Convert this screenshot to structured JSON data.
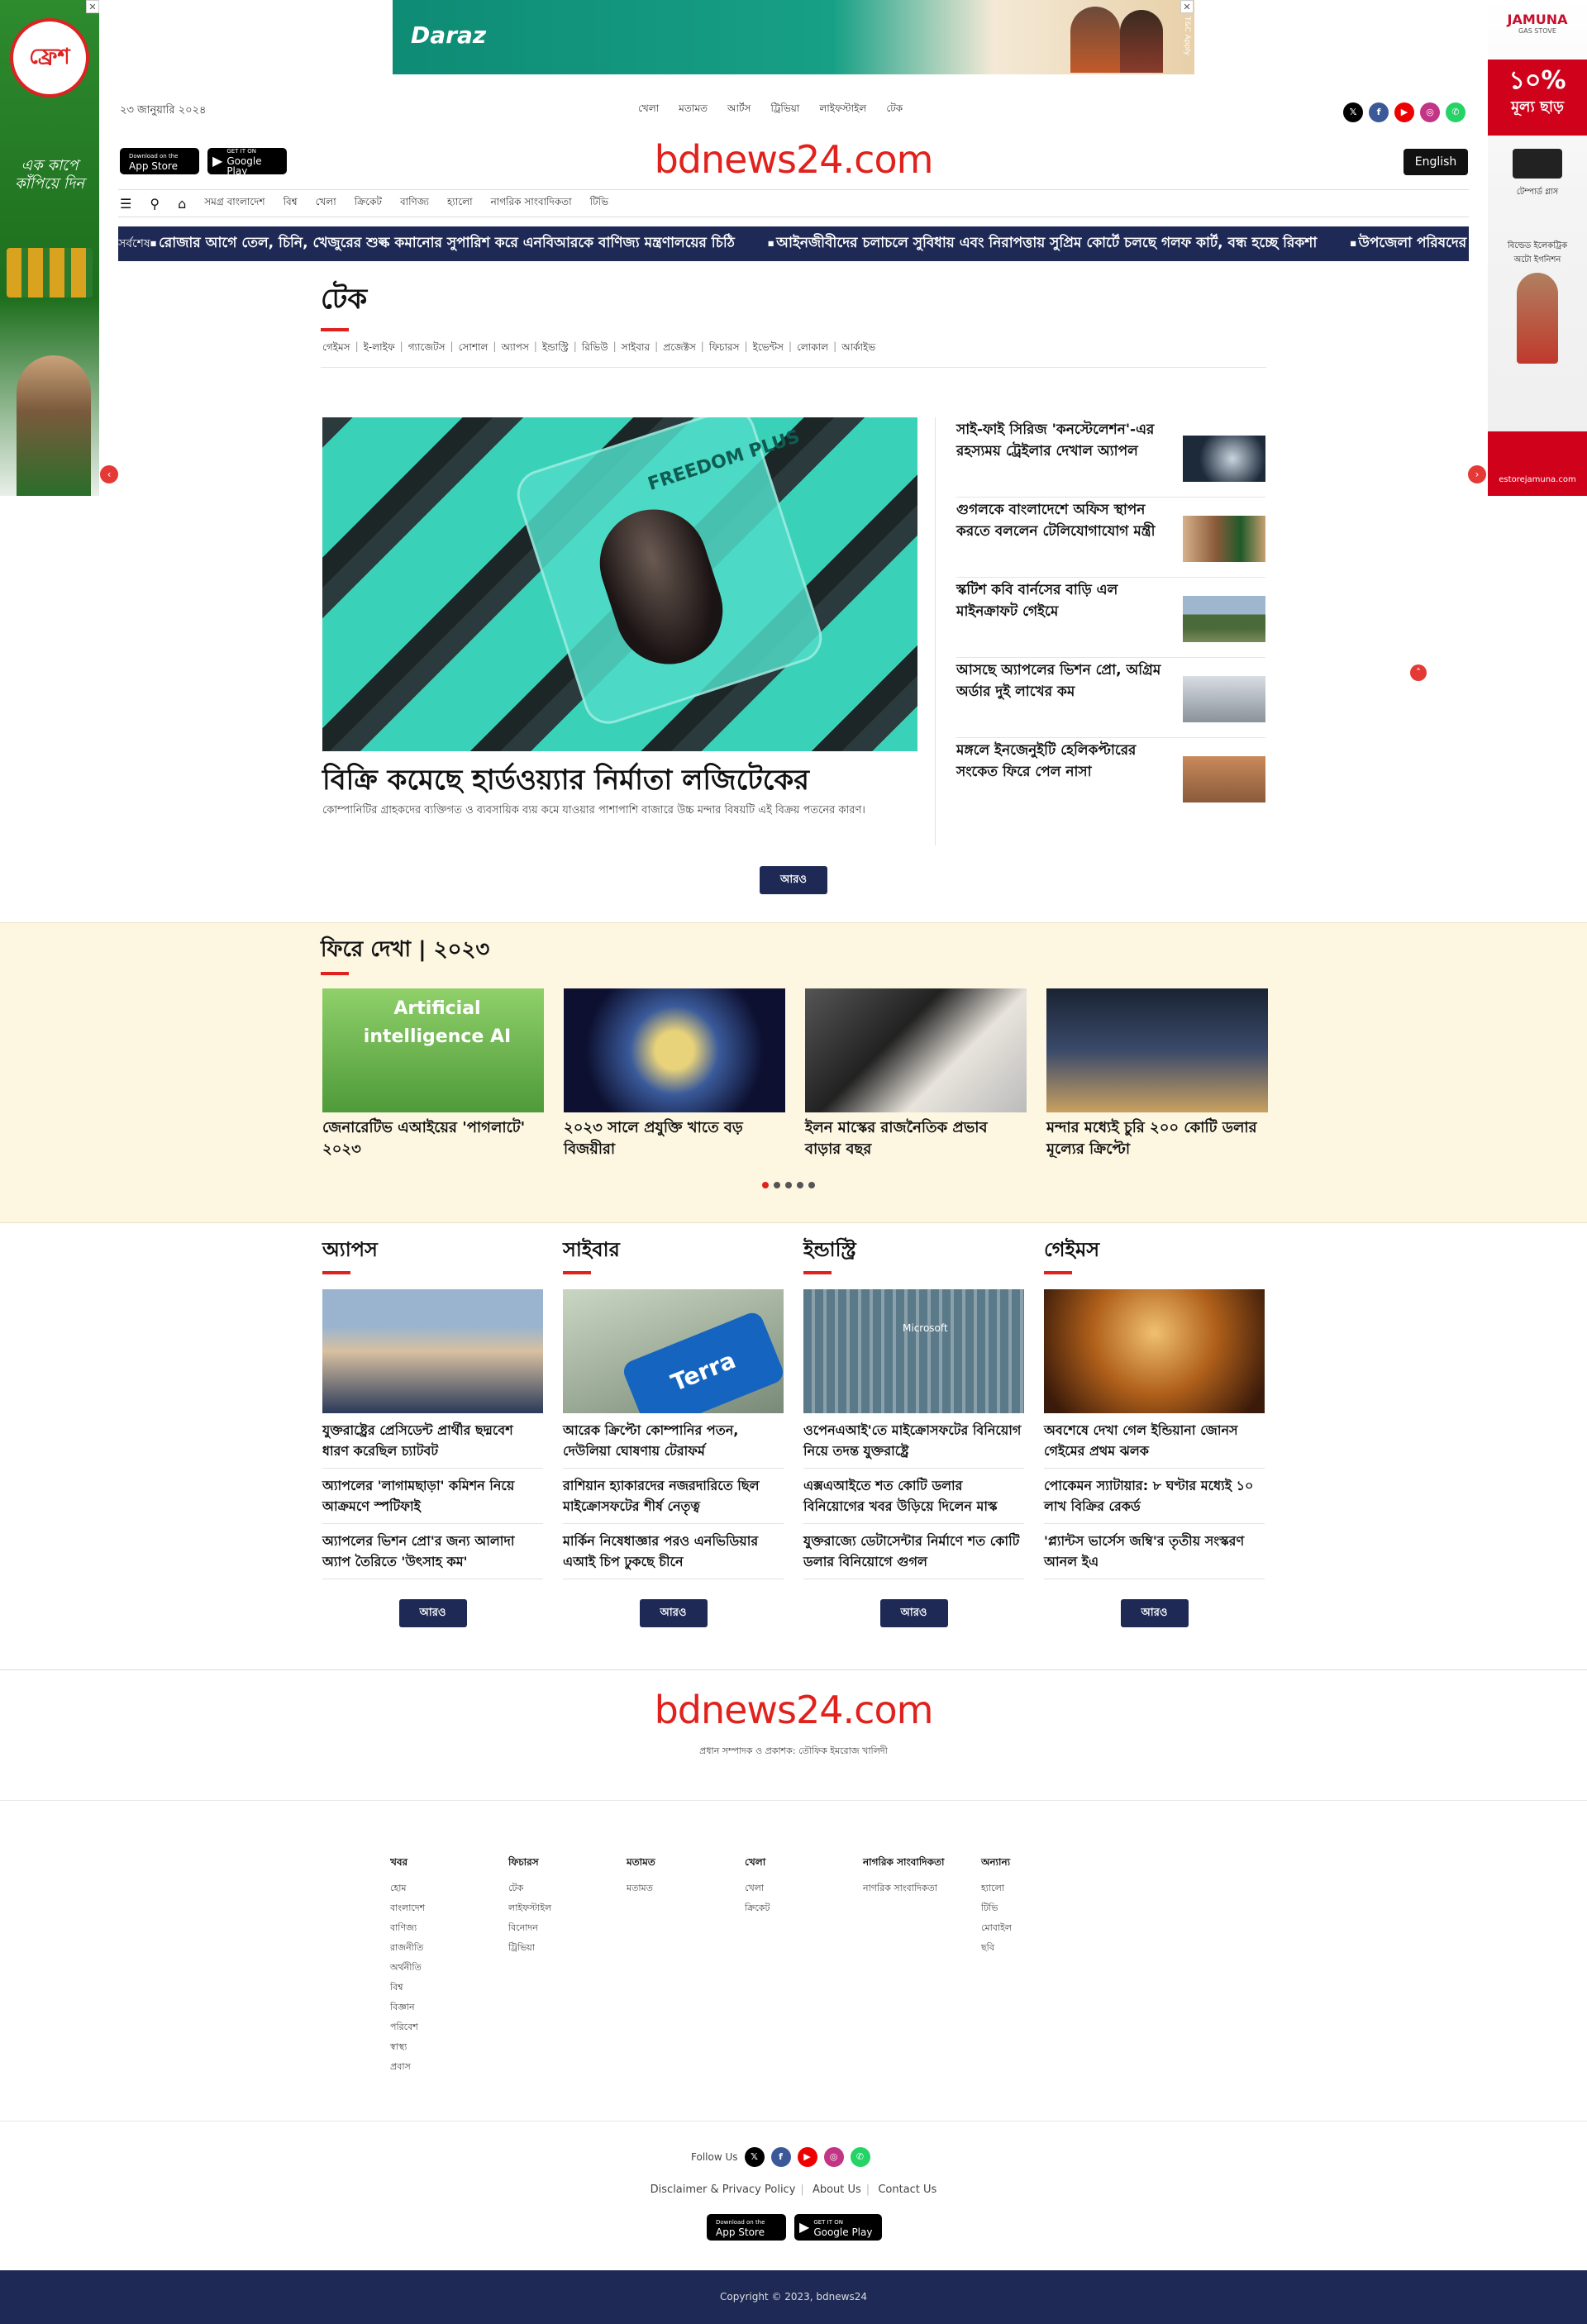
{
  "ads": {
    "left_brand": "ফ্রেশ",
    "left_tagline": "এক কাপে কাঁপিয়ে দিন",
    "right_brand": "JAMUNA",
    "right_brand_sub": "GAS STOVE",
    "right_offer_pct": "১০%",
    "right_offer_text": "মূল্য ছাড়",
    "right_prod1": "টেম্পার্ড গ্লাস",
    "right_prod2": "বিল্ডেড ইলেকট্রিক অটো ইগনিশন",
    "right_site": "estorejamuna.com",
    "banner_brand": "Daraz",
    "banner_tc": "T&C Apply"
  },
  "header": {
    "date": "২৩ জানুয়ারি ২০২৪",
    "top_nav": [
      "খেলা",
      "মতামত",
      "আর্টস",
      "ট্রিভিয়া",
      "লাইফস্টাইল",
      "টেক"
    ],
    "logo": "bdnews24.com",
    "english": "English",
    "app_store": "App Store",
    "app_store_small": "Download on the",
    "google_play": "Google Play",
    "google_play_small": "GET IT ON"
  },
  "nav": [
    "সমগ্র বাংলাদেশ",
    "বিশ্ব",
    "খেলা",
    "ক্রিকেট",
    "বাণিজ্য",
    "হ্যালো",
    "নাগরিক সাংবাদিকতা",
    "টিভি"
  ],
  "ticker": {
    "label": "সর্বশেষ",
    "items": [
      "রোজার আগে তেল, চিনি, খেজুরের শুল্ক কমানোর সুপারিশ করে এনবিআরকে বাণিজ্য মন্ত্রণালয়ের চিঠি",
      "আইনজীবীদের চলাচলে সুবিধায় এবং নিরাপত্তায় সুপ্রিম কোর্টে চলছে গলফ কার্ট, বন্ধ হচ্ছে রিকশা",
      "উপজেলা পরিষদের ভোট মে"
    ]
  },
  "section": {
    "title": "টেক",
    "subnav": [
      "গেইমস",
      "ই-লাইফ",
      "গ্যাজেটস",
      "সোশাল",
      "অ্যাপস",
      "ইন্ডাস্ট্রি",
      "রিভিউ",
      "সাইবার",
      "প্রজেক্টস",
      "ফিচারস",
      "ইভেন্টস",
      "লোকাল",
      "আর্কাইভ"
    ]
  },
  "lead": {
    "title": "বিক্রি কমেছে হার্ডওয়্যার নির্মাতা লজিটেকের",
    "desc": "কোম্পানিটির গ্রাহকদের ব্যক্তিগত ও ব্যবসায়িক ব্যয় কমে যাওয়ার পাশাপাশি বাজারে উচ্চ মন্দার বিষয়টি এই বিক্রয় পতনের কারণ।",
    "img_text": "FREEDOM PLUS"
  },
  "side_news": [
    "সাই-ফাই সিরিজ 'কনস্টেলেশন'-এর রহস্যময় ট্রেইলার দেখাল অ্যাপল",
    "গুগলকে বাংলাদেশে অফিস স্থাপন করতে বললেন টেলিযোগাযোগ মন্ত্রী",
    "স্কটিশ কবি বার্নসের বাড়ি এল মাইনক্রাফট গেইমে",
    "আসছে অ্যাপলের ভিশন প্রো, অগ্রিম অর্ডার দুই লাখের কম",
    "মঙ্গলে ইনজেনুইটি হেলিকপ্টারের সংকেত ফিরে পেল নাসা"
  ],
  "more_label": "আরও",
  "review": {
    "title": "ফিরে দেখা | ২০২৩",
    "cards": [
      {
        "title": "জেনারেটিভ এআইয়ের 'পাগলাটে' ২০২৩",
        "img_text": "Artificial intelligence AI"
      },
      {
        "title": "২০২৩ সালে প্রযুক্তি খাতে বড় বিজয়ীরা",
        "img_text": ""
      },
      {
        "title": "ইলন মাস্কের রাজনৈতিক প্রভাব বাড়ার বছর",
        "img_text": ""
      },
      {
        "title": "মন্দার মধ্যেই চুরি ২০০ কোটি ডলার মূল্যের ক্রিপ্টো",
        "img_text": ""
      }
    ]
  },
  "categories": [
    {
      "title": "অ্যাপস",
      "items": [
        "যুক্তরাষ্ট্রের প্রেসিডেন্ট প্রার্থীর ছদ্মবেশ ধারণ করেছিল চ্যাটবট",
        "অ্যাপলের 'লাগামছাড়া' কমিশন নিয়ে আক্রমণে স্পটিফাই",
        "অ্যাপলের ভিশন প্রো'র জন্য আলাদা অ্যাপ তৈরিতে 'উৎসাহ কম'"
      ]
    },
    {
      "title": "সাইবার",
      "items": [
        "আরেক ক্রিপ্টো কোম্পানির পতন, দেউলিয়া ঘোষণায় টেরাফর্ম",
        "রাশিয়ান হ্যাকারদের নজরদারিতে ছিল মাইক্রোসফটের শীর্ষ নেতৃত্ব",
        "মার্কিন নিষেধাজ্ঞার পরও এনভিডিয়ার এআই চিপ ঢুকছে চীনে"
      ],
      "img_text": "Terra"
    },
    {
      "title": "ইন্ডাস্ট্রি",
      "items": [
        "ওপেনএআই'তে মাইক্রোসফটের বিনিয়োগ নিয়ে তদন্ত যুক্তরাষ্ট্রে",
        "এক্সএআইতে শত কোটি ডলার বিনিয়োগের খবর উড়িয়ে দিলেন মাস্ক",
        "যুক্তরাজ্যে ডেটাসেন্টার নির্মাণে শত কোটি ডলার বিনিয়োগে গুগল"
      ],
      "img_text": "Microsoft"
    },
    {
      "title": "গেইমস",
      "items": [
        "অবশেষে দেখা গেল ইন্ডিয়ানা জোনস গেইমের প্রথম ঝলক",
        "পোকেমন স্যাটায়ার: ৮ ঘণ্টার মধ্যেই ১০ লাখ বিক্রির রেকর্ড",
        "'প্ল্যান্টস ভার্সেস জম্বি'র তৃতীয় সংস্করণ আনল ইএ"
      ]
    }
  ],
  "footer": {
    "logo": "bdnews24.com",
    "editor": "প্রধান সম্পাদক ও প্রকাশক: তৌফিক ইমরোজ খালিদী",
    "columns": [
      {
        "title": "খবর",
        "items": [
          "হোম",
          "বাংলাদেশ",
          "বাণিজ্য",
          "রাজনীতি",
          "অর্থনীতি",
          "বিশ্ব",
          "বিজ্ঞান",
          "পরিবেশ",
          "স্বাস্থ্য",
          "প্রবাস"
        ]
      },
      {
        "title": "ফিচারস",
        "items": [
          "টেক",
          "লাইফস্টাইল",
          "বিনোদন",
          "ট্রিভিয়া"
        ]
      },
      {
        "title": "মতামত",
        "items": [
          "মতামত"
        ]
      },
      {
        "title": "খেলা",
        "items": [
          "খেলা",
          "ক্রিকেট"
        ]
      },
      {
        "title": "নাগরিক সাংবাদিকতা",
        "items": [
          "নাগরিক সাংবাদিকতা"
        ]
      },
      {
        "title": "অন্যান্য",
        "items": [
          "হ্যালো",
          "টিভি",
          "মোবাইল",
          "ছবি"
        ]
      }
    ],
    "follow": "Follow Us",
    "links": [
      "Disclaimer & Privacy Policy",
      "About Us",
      "Contact Us"
    ],
    "copyright": "Copyright © 2023, bdnews24"
  },
  "colors": {
    "brand_red": "#e0211c",
    "navy": "#1e2a55",
    "review_bg": "#fdf7e2"
  }
}
